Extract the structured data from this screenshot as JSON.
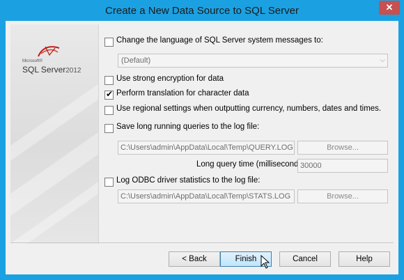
{
  "window": {
    "title": "Create a New Data Source to SQL Server",
    "close_glyph": "✕"
  },
  "logo": {
    "microsoft": "Microsoft®",
    "product": "SQL Server",
    "year": "2012"
  },
  "options": {
    "change_language": {
      "label": "Change the language of SQL Server system messages to:",
      "checked": false
    },
    "language_select": {
      "value": "(Default)"
    },
    "strong_encryption": {
      "label": "Use strong encryption for data",
      "checked": false
    },
    "perform_translation": {
      "label": "Perform translation for character data",
      "checked": true
    },
    "regional_settings": {
      "label": "Use regional settings when outputting currency, numbers, dates and times.",
      "checked": false
    },
    "save_long_queries": {
      "label": "Save long running queries to the log file:",
      "checked": false
    },
    "query_log_path": "C:\\Users\\admin\\AppData\\Local\\Temp\\QUERY.LOG",
    "query_browse": "Browse...",
    "long_query_time_label": "Long query time (milliseconds):",
    "long_query_time_value": "30000",
    "log_odbc_stats": {
      "label": "Log ODBC driver statistics to the log file:",
      "checked": false
    },
    "stats_log_path": "C:\\Users\\admin\\AppData\\Local\\Temp\\STATS.LOG",
    "stats_browse": "Browse..."
  },
  "buttons": {
    "back": "< Back",
    "finish": "Finish",
    "cancel": "Cancel",
    "help": "Help"
  },
  "colors": {
    "frame": "#1ba1e2",
    "close": "#c75050",
    "default_button": "#bee6fd"
  }
}
